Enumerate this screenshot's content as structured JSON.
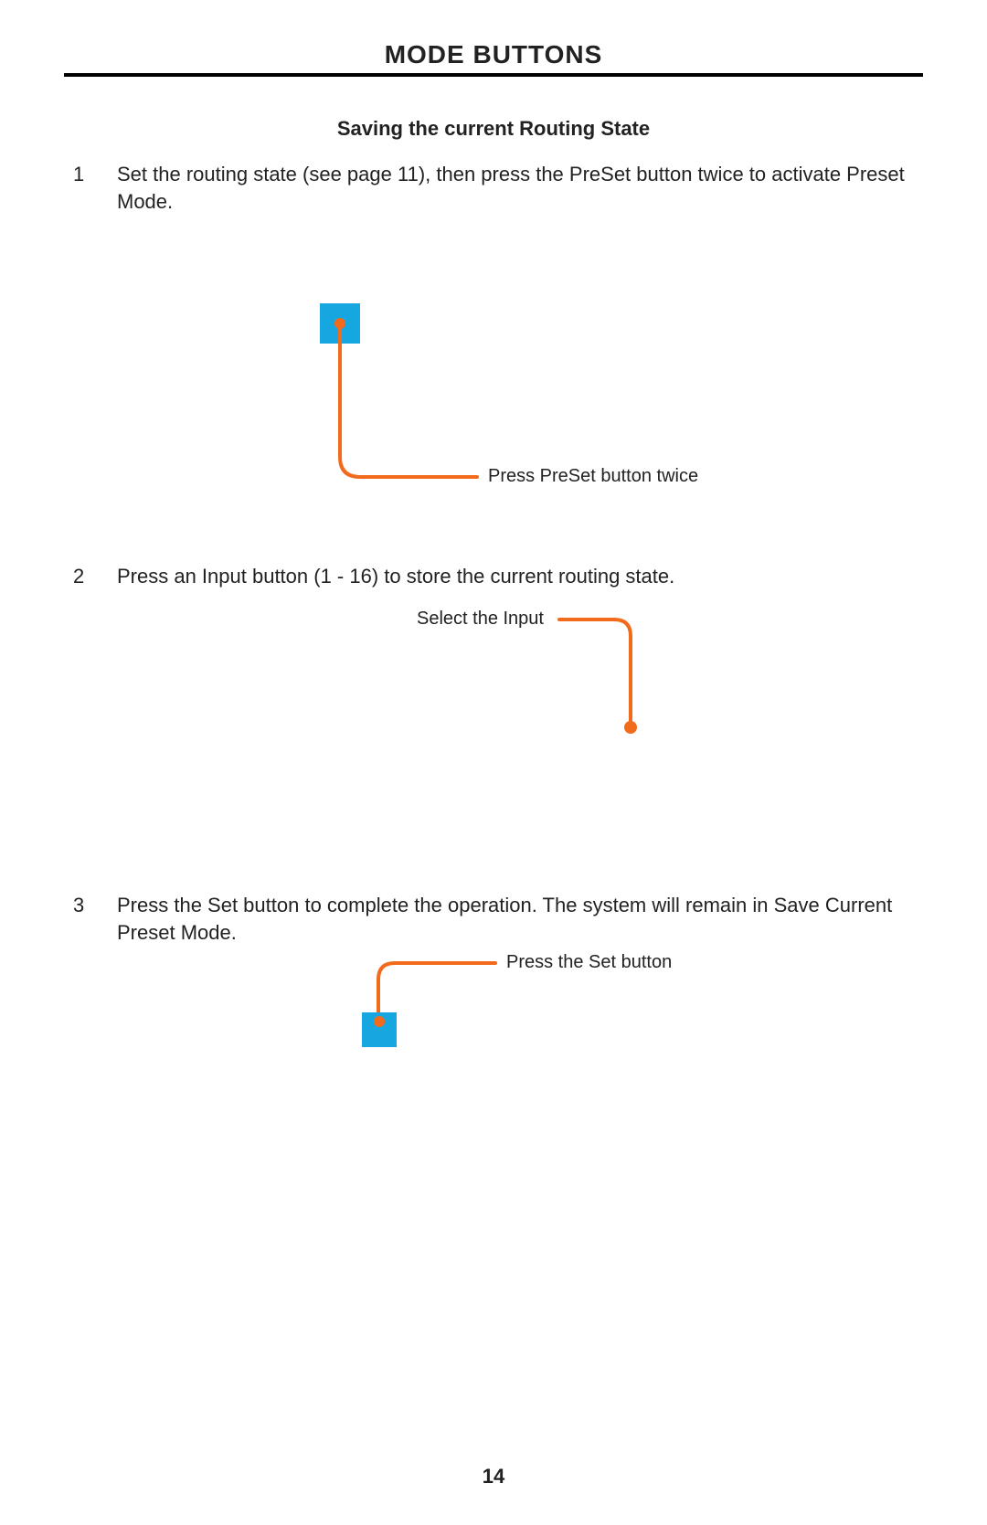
{
  "title": "MODE BUTTONS",
  "subtitle": "Saving the current Routing State",
  "steps": {
    "s1": {
      "num": "1",
      "text": "Set the routing state (see page 11), then press the PreSet button twice to activate Preset Mode."
    },
    "s2": {
      "num": "2",
      "text": "Press an Input button (1 - 16) to store the current routing state."
    },
    "s3": {
      "num": "3",
      "text": "Press the Set button to complete the operation.  The system will remain in Save Current Preset Mode."
    }
  },
  "callouts": {
    "c1": "Press PreSet button twice",
    "c2": "Select the Input",
    "c3": "Press the Set button"
  },
  "page_number": "14"
}
